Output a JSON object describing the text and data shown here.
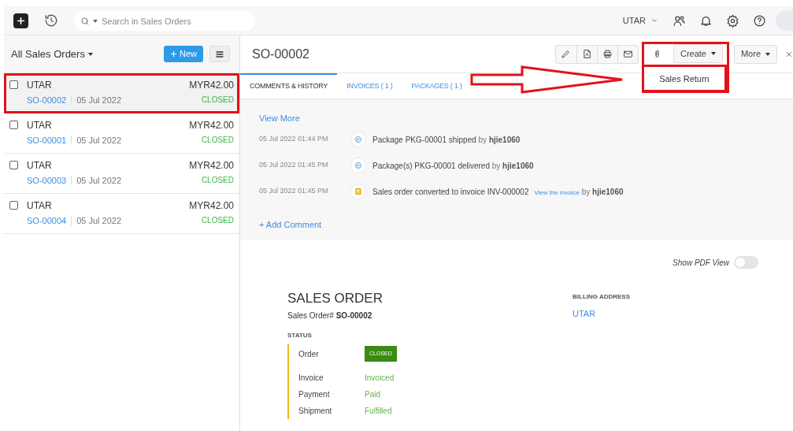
{
  "top_bar": {
    "search": {
      "placeholder": "Search in Sales Orders"
    },
    "organization": "UTAR"
  },
  "list": {
    "title": "All Sales Orders",
    "new_button": "New",
    "orders": [
      {
        "customer": "UTAR",
        "number": "SO-00002",
        "date": "05 Jul 2022",
        "amount": "MYR42.00",
        "status": "CLOSED",
        "checked": false,
        "selected": true,
        "annotated": true
      },
      {
        "customer": "UTAR",
        "number": "SO-00001",
        "date": "05 Jul 2022",
        "amount": "MYR42.00",
        "status": "CLOSED",
        "checked": false,
        "selected": false,
        "annotated": false
      },
      {
        "customer": "UTAR",
        "number": "SO-00003",
        "date": "05 Jul 2022",
        "amount": "MYR42.00",
        "status": "CLOSED",
        "checked": false,
        "selected": false,
        "annotated": false
      },
      {
        "customer": "UTAR",
        "number": "SO-00004",
        "date": "05 Jul 2022",
        "amount": "MYR42.00",
        "status": "CLOSED",
        "checked": false,
        "selected": false,
        "annotated": false
      }
    ]
  },
  "detail": {
    "title": "SO-00002",
    "create_button": "Create",
    "more_button": "More",
    "create_menu": {
      "annotated": true,
      "items": [
        "Sales Return"
      ]
    },
    "tabs": [
      {
        "label": "COMMENTS & HISTORY",
        "selected": true
      },
      {
        "label": "INVOICES ( 1 )",
        "selected": false
      },
      {
        "label": "PACKAGES ( 1 )",
        "selected": false
      }
    ],
    "view_more": "View More",
    "history": [
      {
        "time": "05 Jul 2022 01:44 PM",
        "kind": "comment",
        "text": "Package PKG-00001 shipped",
        "by": "by",
        "user": "hjie1060"
      },
      {
        "time": "05 Jul 2022 01:45 PM",
        "kind": "comment",
        "text": "Package(s) PKG-00001 delivered",
        "by": "by",
        "user": "hjie1060"
      },
      {
        "time": "05 Jul 2022 01:45 PM",
        "kind": "invoice",
        "text": "Sales order converted to invoice INV-000002",
        "link": "View the invoice",
        "by": "by",
        "user": "hjie1060"
      }
    ],
    "add_comment": "+ Add Comment",
    "pdf_toggle": {
      "label": "Show PDF View",
      "on": false
    },
    "document": {
      "heading": "SALES ORDER",
      "number_line": "Sales Order# **SO-00002**",
      "status_heading": "STATUS",
      "statuses": [
        {
          "label": "Order",
          "value": "CLOSED",
          "kind": "badge"
        },
        {
          "label": "Invoice",
          "value": "Invoiced",
          "kind": "text"
        },
        {
          "label": "Payment",
          "value": "Paid",
          "kind": "text"
        },
        {
          "label": "Shipment",
          "value": "Fulfilled",
          "kind": "text"
        }
      ],
      "billing_heading": "BILLING ADDRESS",
      "billing_name": "UTAR"
    }
  }
}
